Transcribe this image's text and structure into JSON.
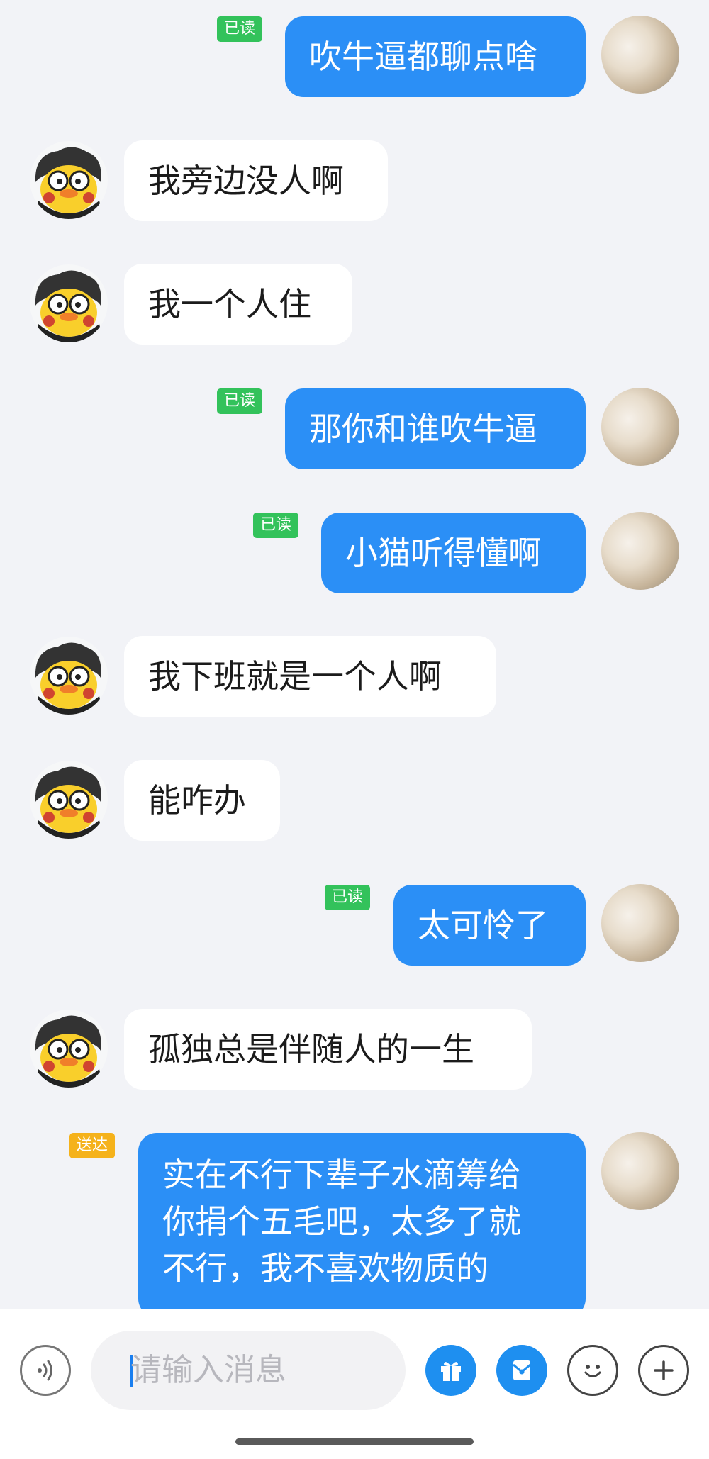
{
  "messages": [
    {
      "side": "out",
      "status": "已读",
      "text": "吹牛逼都聊点啥"
    },
    {
      "side": "in",
      "text": "我旁边没人啊"
    },
    {
      "side": "in",
      "text": "我一个人住"
    },
    {
      "side": "out",
      "status": "已读",
      "text": "那你和谁吹牛逼"
    },
    {
      "side": "out",
      "status": "已读",
      "text": "小猫听得懂啊"
    },
    {
      "side": "in",
      "text": "我下班就是一个人啊"
    },
    {
      "side": "in",
      "text": "能咋办"
    },
    {
      "side": "out",
      "status": "已读",
      "text": "太可怜了"
    },
    {
      "side": "in",
      "text": "孤独总是伴随人的一生"
    },
    {
      "side": "out",
      "status": "送达",
      "text_lines": [
        "实在不行下辈子水滴筹给",
        "你捐个五毛吧，太多了就",
        "不行，我不喜欢物质的"
      ]
    }
  ],
  "input": {
    "placeholder": "请输入消息"
  },
  "toolbar": {
    "icons": [
      "voice-icon",
      "gift-icon",
      "red-packet-icon",
      "emoji-icon",
      "plus-icon"
    ]
  },
  "colors": {
    "out_bubble": "#2b8ff6",
    "in_bubble": "#ffffff",
    "read_badge": "#33c25b",
    "sent_badge": "#f5b21b",
    "background": "#f2f3f7"
  }
}
